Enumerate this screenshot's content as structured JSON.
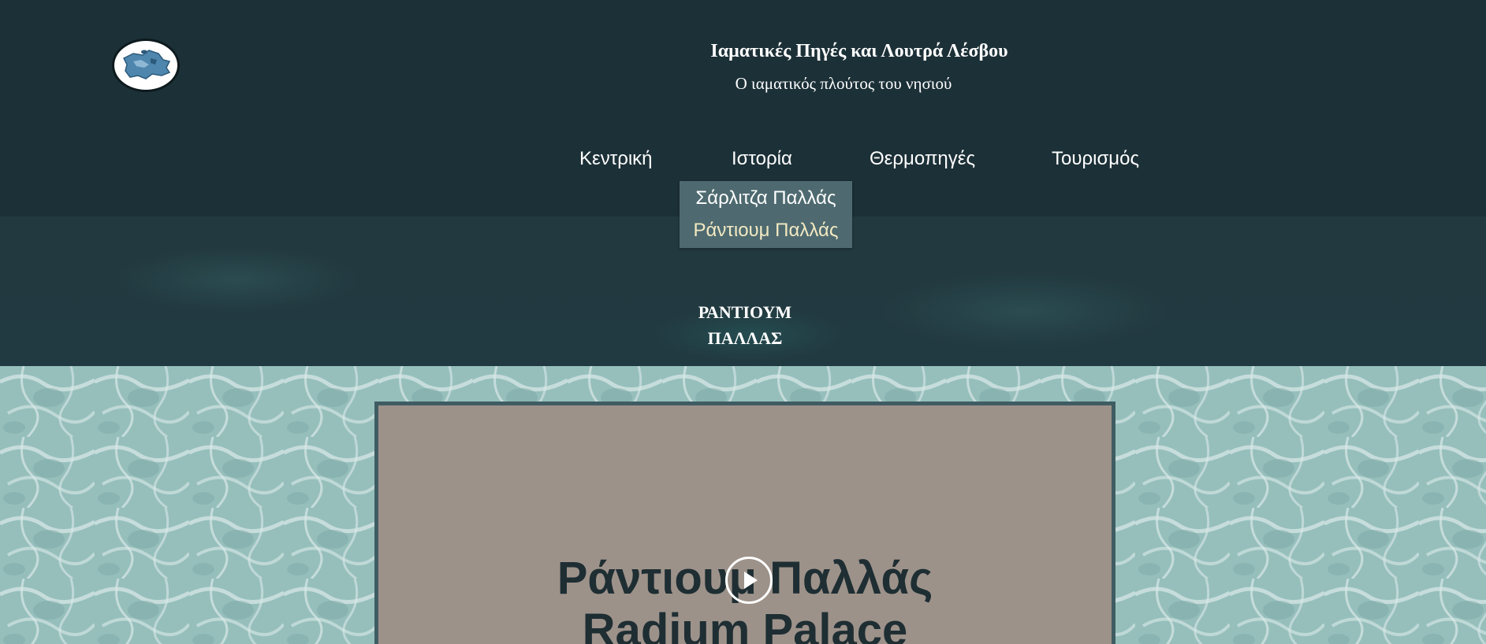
{
  "header": {
    "title": "Ιαματικές Πηγές και Λουτρά Λέσβου",
    "subtitle": "Ο ιαματικός πλούτος του νησιού",
    "logo_icon": "lesvos-island-logo"
  },
  "nav": {
    "items": [
      {
        "label": "Κεντρική"
      },
      {
        "label": "Ιστορία"
      },
      {
        "label": "Θερμοπηγές"
      },
      {
        "label": "Τουρισμός"
      }
    ],
    "dropdown": [
      {
        "label": "Σάρλιτζα Παλλάς"
      },
      {
        "label": "Ράντιουμ Παλλάς"
      }
    ]
  },
  "page": {
    "heading_line1": "ΡΑΝΤΙΟΥΜ",
    "heading_line2": "ΠΑΛΛΑΣ"
  },
  "video": {
    "title_line1": "Ράντιουμ Παλλάς",
    "title_line2": "Radium Palace",
    "play_icon": "play-icon"
  },
  "colors": {
    "header_bg": "#1c3037",
    "dropdown_bg": "#4e6a70",
    "dropdown_active_text": "#f3e9c2",
    "video_bg": "#9d928a",
    "water": "#a8cdc9"
  }
}
